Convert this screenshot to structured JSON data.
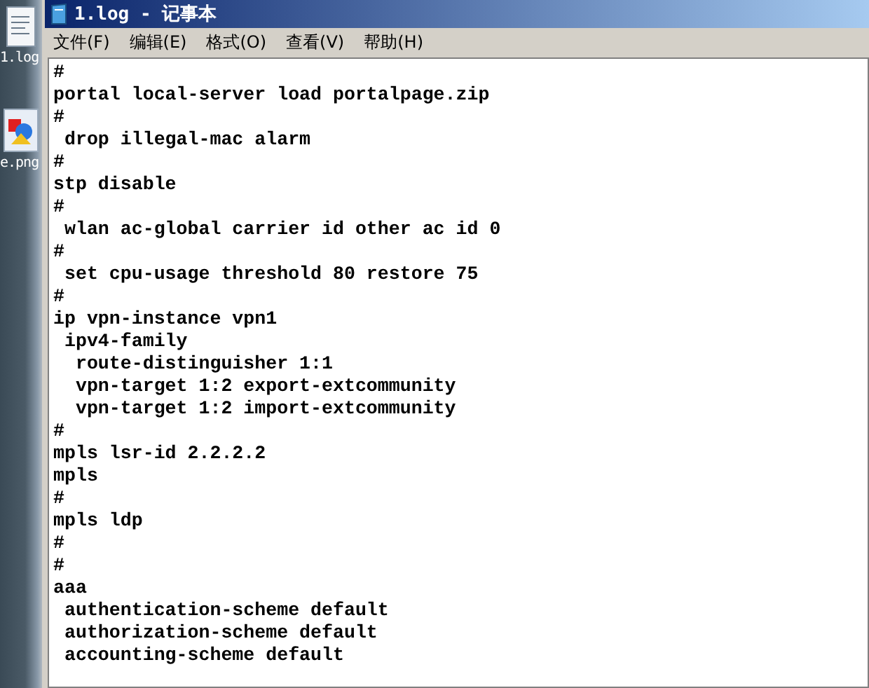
{
  "desktop": {
    "icons": [
      {
        "kind": "text-file",
        "label": "1.log"
      },
      {
        "kind": "image-file",
        "label": "e.png"
      }
    ]
  },
  "window": {
    "title": "1.log - 记事本"
  },
  "menu": [
    "文件(F)",
    "编辑(E)",
    "格式(O)",
    "查看(V)",
    "帮助(H)"
  ],
  "lines": [
    "#",
    "portal local-server load portalpage.zip",
    "#",
    " drop illegal-mac alarm",
    "#",
    "stp disable",
    "#",
    " wlan ac-global carrier id other ac id 0",
    "#",
    " set cpu-usage threshold 80 restore 75",
    "#",
    "ip vpn-instance vpn1",
    " ipv4-family",
    "  route-distinguisher 1:1",
    "  vpn-target 1:2 export-extcommunity",
    "  vpn-target 1:2 import-extcommunity",
    "#",
    "mpls lsr-id 2.2.2.2",
    "mpls",
    "#",
    "mpls ldp",
    "#",
    "#",
    "aaa",
    " authentication-scheme default",
    " authorization-scheme default",
    " accounting-scheme default"
  ]
}
